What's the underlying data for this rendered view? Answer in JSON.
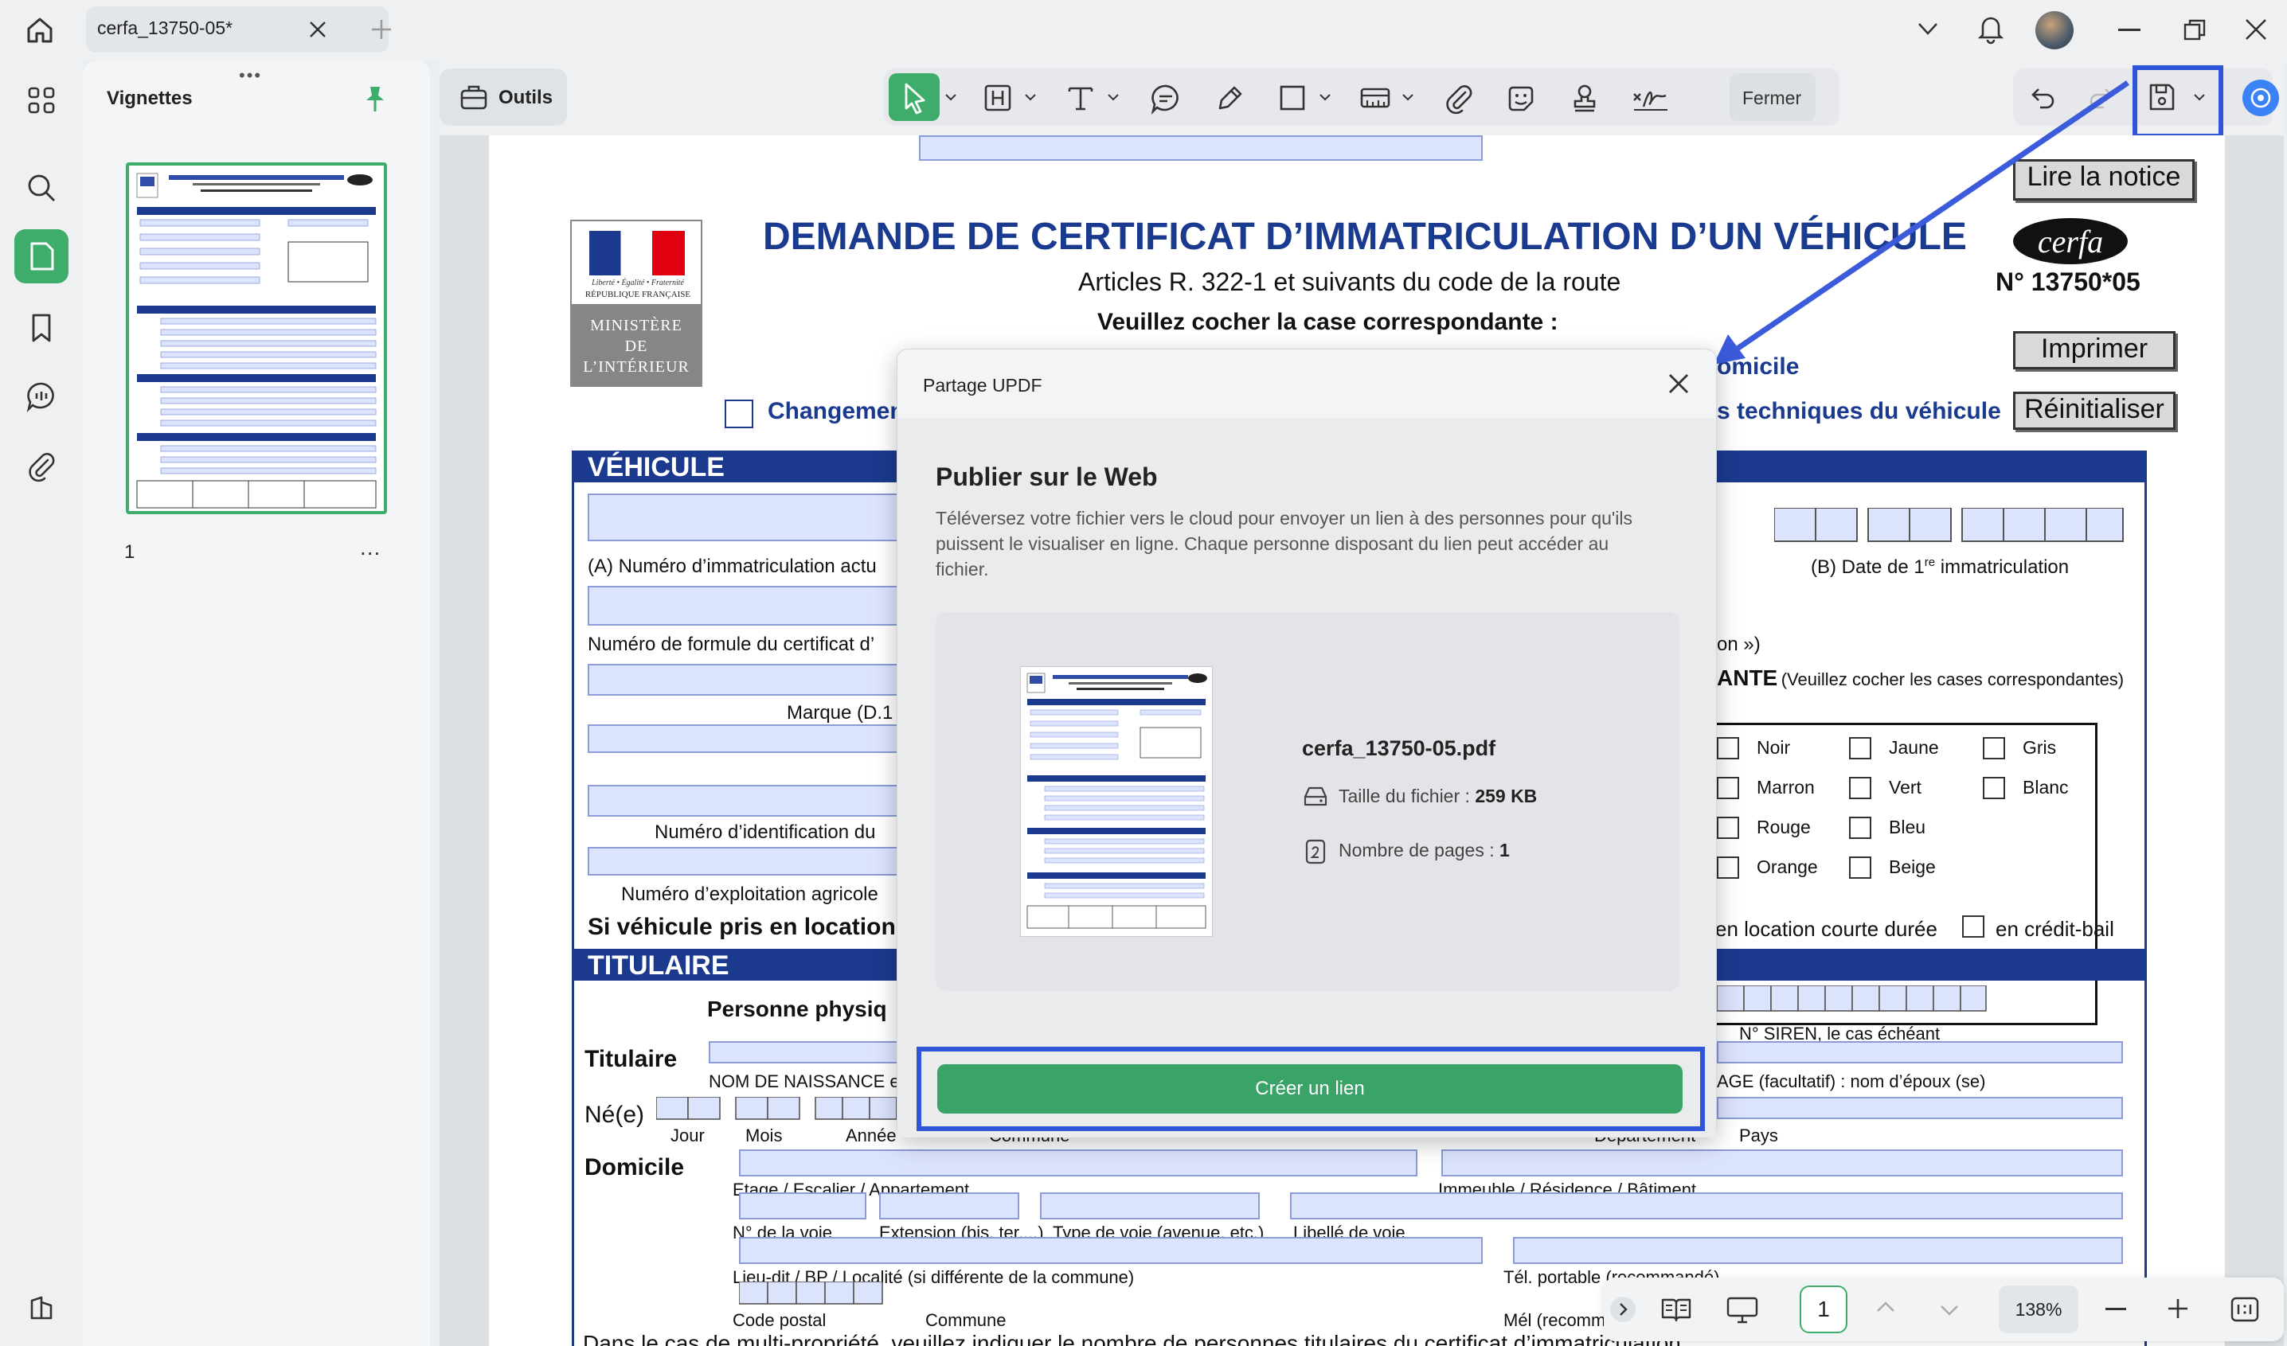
{
  "window": {
    "tab_title": "cerfa_13750-05*"
  },
  "sidebar": {
    "panel_title": "Vignettes",
    "page_number": "1",
    "more": "..."
  },
  "toolbar": {
    "tools_label": "Outils",
    "close_label": "Fermer"
  },
  "form": {
    "title": "DEMANDE DE CERTIFICAT D’IMMATRICULATION D’UN VÉHICULE",
    "subtitle": "Articles R. 322-1 et suivants du code de la route",
    "instruction": "Veuillez cocher la case correspondante :",
    "cerfa_logo": "cerfa",
    "cerfa_number": "N° 13750*05",
    "btn_notice": "Lire la notice",
    "btn_print": "Imprimer",
    "btn_reset": "Réinitialiser",
    "ministry": [
      "MINISTÈRE",
      "DE",
      "L’INTÉRIEUR"
    ],
    "republic": "RÉPUBLIQUE FRANÇAISE",
    "motto": "Liberté • Égalité • Fraternité",
    "changement": "Changemen",
    "domicile_frag": "omicile",
    "tech_frag": "s techniques du véhicule",
    "section_vehicule": "VÉHICULE",
    "section_titulaire": "TITULAIRE",
    "labels": {
      "num_immat": "(A) Numéro d’immatriculation actu",
      "date_immat": "(B) Date de 1",
      "date_immat_sup": "re",
      "date_immat_end": " immatriculation",
      "num_formule": "Numéro de formule du certificat d’",
      "on_frag": "on »)",
      "marque": "Marque (D.1",
      "ante": "ANTE",
      "ante_note": "(Veuillez cocher les cases correspondantes)",
      "num_ident": "Numéro d’identification du",
      "num_expl": "Numéro d’exploitation agricole",
      "location": "Si véhicule pris en location,",
      "location_courte": "en location courte durée",
      "credit_bail": "en crédit-bail",
      "personne": "Personne physiq",
      "titulaire": "Titulaire",
      "siren": "N° SIREN, le cas échéant",
      "nom_naissance": "NOM DE NAISSANCE e",
      "usage": "AGE (facultatif) : nom d’époux (se)",
      "ne": "Né(e)",
      "jour": "Jour",
      "mois": "Mois",
      "annee": "Année",
      "commune": "Commune",
      "departement": "Département",
      "pays": "Pays",
      "domicile": "Domicile",
      "etage": "Etage / Escalier / Appartement",
      "immeuble": "Immeuble / Résidence / Bâtiment",
      "no_voie": "N° de la voie",
      "extension": "Extension (bis, ter,...)",
      "type_voie": "Type de voie (avenue, etc.)",
      "libelle": "Libellé de voie",
      "lieu_dit": "Lieu-dit / BP / Localité (si différente de la commune)",
      "tel": "Tél. portable (recommandé)",
      "code_postal": "Code postal",
      "commune2": "Commune",
      "mel": "Mél (recomm",
      "bottom_note": "Dans le cas de multi-propriété, veuillez indiquer le nombre de personnes titulaires du certificat d’immatriculation"
    },
    "colors": [
      [
        "Noir",
        "Jaune",
        "Gris"
      ],
      [
        "Marron",
        "Vert",
        "Blanc"
      ],
      [
        "Rouge",
        "Bleu",
        ""
      ],
      [
        "Orange",
        "Beige",
        ""
      ]
    ]
  },
  "dialog": {
    "window_title": "Partage UPDF",
    "heading": "Publier sur le Web",
    "description": "Téléversez votre fichier vers le cloud pour envoyer un lien à des personnes pour qu'ils puissent le visualiser en ligne. Chaque personne disposant du lien peut accéder au fichier.",
    "file_name": "cerfa_13750-05.pdf",
    "size_label": "Taille du fichier :",
    "size_value": "259 KB",
    "pages_label": "Nombre de pages :",
    "pages_value": "1",
    "create_button": "Créer un lien"
  },
  "bottombar": {
    "page_input": "1",
    "zoom": "138%"
  },
  "colors_theme": {
    "accent_green": "#3ead6b",
    "highlight_blue": "#2f55d9",
    "form_navy": "#1b3a8e",
    "field_fill": "#dce3fd"
  }
}
